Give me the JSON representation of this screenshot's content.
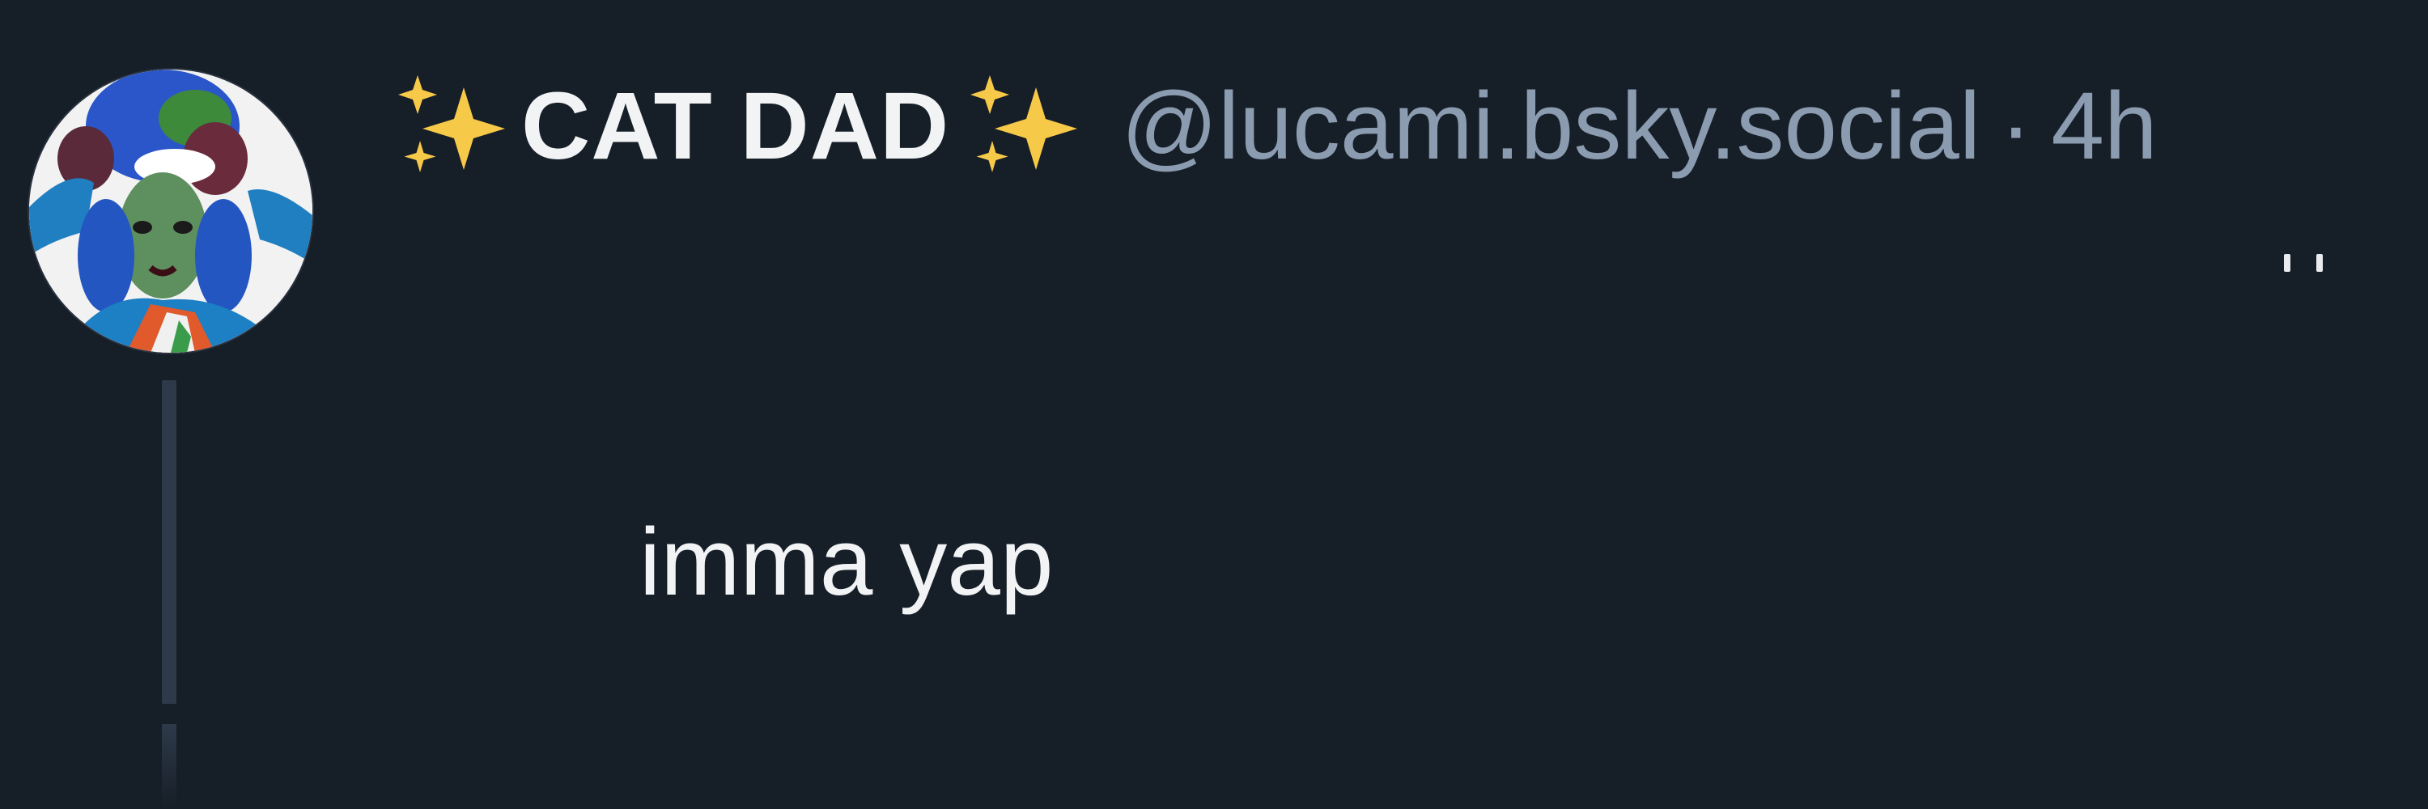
{
  "post": {
    "author": {
      "display_name": "CAT DAD",
      "name_emoji": "sparkles-icon",
      "handle": "@lucami.bsky.social",
      "avatar": "user-avatar"
    },
    "separator": "·",
    "timestamp": "4h",
    "text": "imma yap",
    "menu_icon": "more-options-icon"
  },
  "colors": {
    "background": "#161e27",
    "name_text": "#f1f3f5",
    "meta_text": "#8b9bb0",
    "thread_line": "#2e3a4a",
    "sparkle": "#f7c948"
  }
}
